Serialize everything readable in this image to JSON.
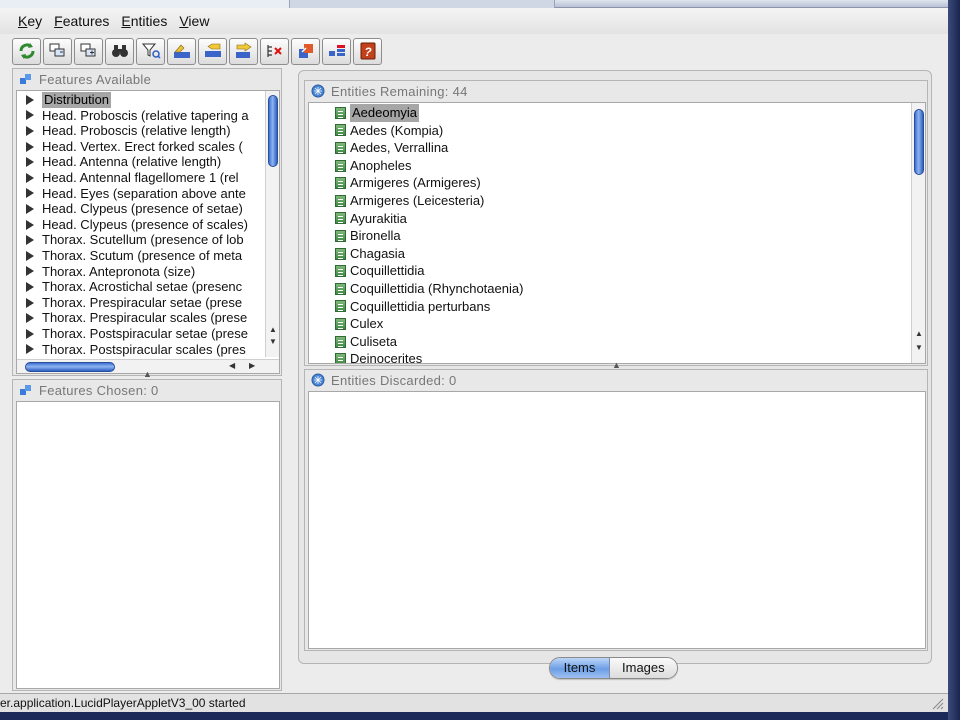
{
  "menu": [
    {
      "label": "Key",
      "underline": "K",
      "rest": "ey"
    },
    {
      "label": "Features",
      "underline": "F",
      "rest": "eatures"
    },
    {
      "label": "Entities",
      "underline": "E",
      "rest": "ntities"
    },
    {
      "label": "View",
      "underline": "V",
      "rest": "iew"
    }
  ],
  "toolbar_icons": [
    "restart-icon",
    "features-used-icon",
    "features-unused-icon",
    "find-icon",
    "filter-icon",
    "best-feature-icon",
    "prune-icon",
    "next-feature-icon",
    "clear-chosen-icon",
    "differences-icon",
    "similarities-icon",
    "help-icon"
  ],
  "features_available": {
    "title": "Features Available",
    "items": [
      "Distribution",
      "Head. Proboscis (relative tapering a",
      "Head. Proboscis (relative length)",
      "Head. Vertex. Erect forked scales (",
      "Head. Antenna (relative length)",
      "Head. Antennal flagellomere 1 (rel",
      "Head. Eyes (separation above ante",
      "Head. Clypeus (presence of setae)",
      "Head. Clypeus (presence of scales)",
      "Thorax. Scutellum (presence of lob",
      "Thorax. Scutum (presence of meta",
      "Thorax. Antepronota (size)",
      "Thorax. Acrostichal setae (presenc",
      "Thorax. Prespiracular setae (prese",
      "Thorax. Prespiracular scales (prese",
      "Thorax. Postspiracular setae (prese",
      "Thorax. Postspiracular scales (pres"
    ]
  },
  "features_chosen": {
    "title": "Features Chosen: 0"
  },
  "entities_remaining": {
    "title": "Entities Remaining: 44",
    "items": [
      "Aedeomyia",
      "Aedes (Kompia)",
      "Aedes, Verrallina",
      "Anopheles",
      "Armigeres (Armigeres)",
      "Armigeres (Leicesteria)",
      "Ayurakitia",
      "Bironella",
      "Chagasia",
      "Coquillettidia",
      "Coquillettidia (Rhynchotaenia)",
      "Coquillettidia perturbans",
      "Culex",
      "Culiseta",
      "Deinocerites"
    ]
  },
  "entities_discarded": {
    "title": "Entities Discarded: 0"
  },
  "view_tabs": {
    "items": "Items",
    "images": "Images"
  },
  "status_text": "er.application.LucidPlayerAppletV3_00 started",
  "colors": {
    "selection": "#a6a6a6",
    "scroll_thumb": "#3b6fd1",
    "active_tab": "#6c9fe6",
    "background": "#ececec"
  }
}
